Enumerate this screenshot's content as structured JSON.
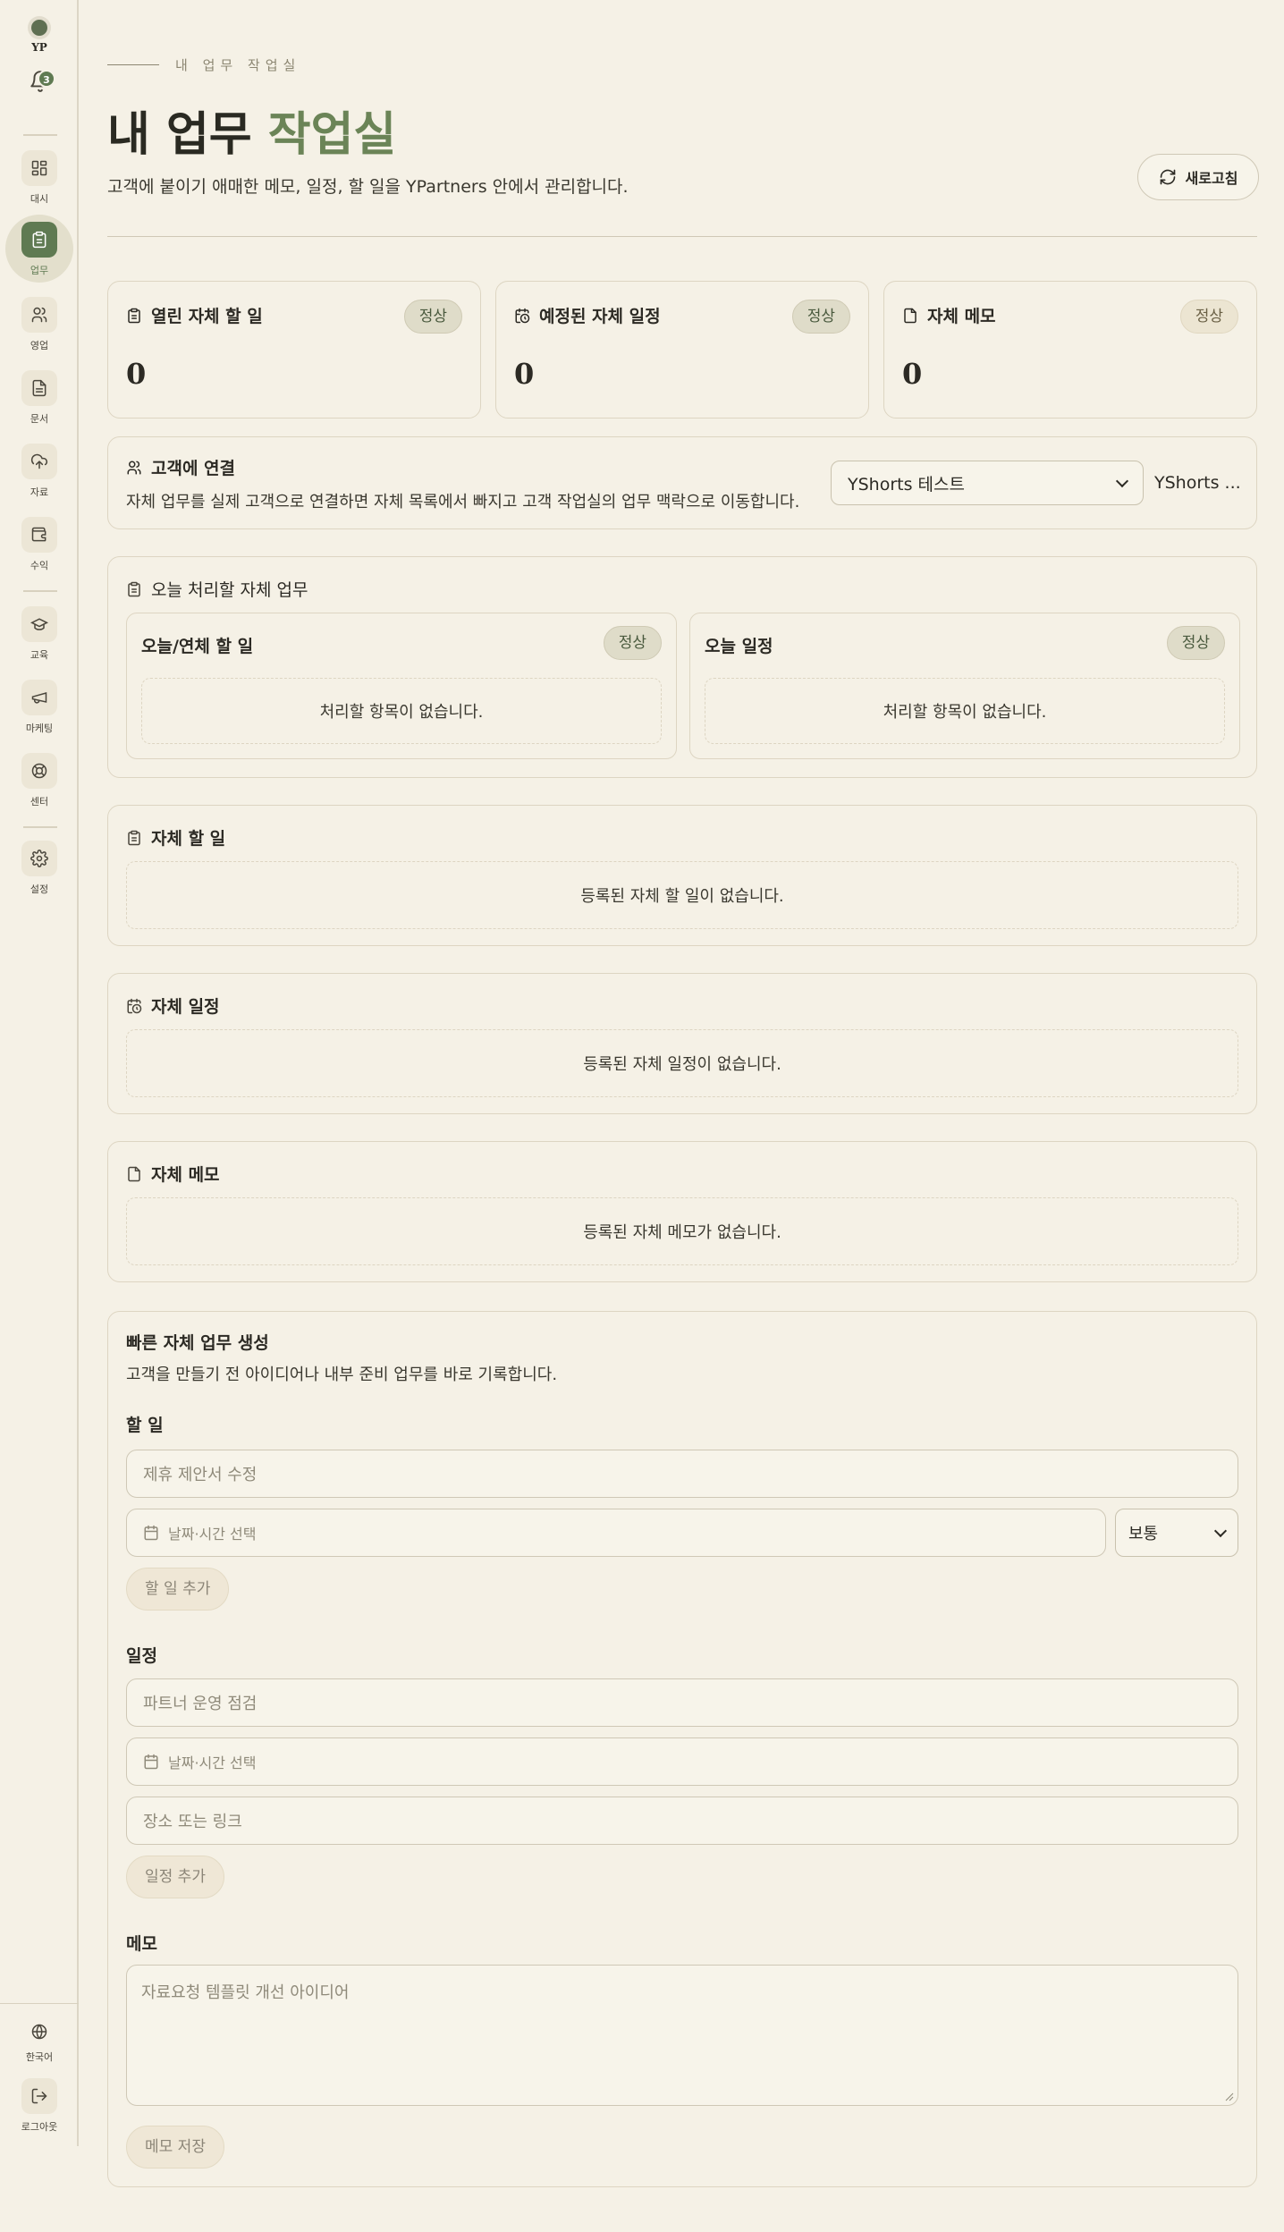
{
  "brand": {
    "text": "YP"
  },
  "notifications": {
    "count": "3"
  },
  "nav": [
    {
      "label": "대시"
    },
    {
      "label": "업무"
    },
    {
      "label": "영업"
    },
    {
      "label": "문서"
    },
    {
      "label": "자료"
    },
    {
      "label": "수익"
    },
    {
      "label": "교육"
    },
    {
      "label": "마케팅"
    },
    {
      "label": "센터"
    },
    {
      "label": "설정"
    }
  ],
  "footer_nav": [
    {
      "label": "한국어"
    },
    {
      "label": "로그아웃"
    }
  ],
  "header": {
    "eyebrow": "내 업무 작업실",
    "title_main": "내 업무 ",
    "title_accent": "작업실",
    "subtitle": "고객에 붙이기 애매한 메모, 일정, 할 일을 YPartners 안에서 관리합니다.",
    "refresh_label": "새로고침"
  },
  "stats": [
    {
      "label": "열린 자체 할 일",
      "status": "정상",
      "value": "0"
    },
    {
      "label": "예정된 자체 일정",
      "status": "정상",
      "value": "0"
    },
    {
      "label": "자체 메모",
      "status": "정상",
      "value": "0"
    }
  ],
  "link_customer": {
    "title": "고객에 연결",
    "description": "자체 업무를 실제 고객으로 연결하면 자체 목록에서 빠지고 고객 작업실의 업무 맥락으로 이동합니다.",
    "selected": "YShorts 테스트",
    "trailing": "YShorts ..."
  },
  "today": {
    "title": "오늘 처리할 자체 업무",
    "columns": [
      {
        "title": "오늘/연체 할 일",
        "status": "정상",
        "empty": "처리할 항목이 없습니다."
      },
      {
        "title": "오늘 일정",
        "status": "정상",
        "empty": "처리할 항목이 없습니다."
      }
    ]
  },
  "todos": {
    "title": "자체 할 일",
    "empty": "등록된 자체 할 일이 없습니다."
  },
  "events": {
    "title": "자체 일정",
    "empty": "등록된 자체 일정이 없습니다."
  },
  "memos": {
    "title": "자체 메모",
    "empty": "등록된 자체 메모가 없습니다."
  },
  "quick": {
    "title": "빠른 자체 업무 생성",
    "description": "고객을 만들기 전 아이디어나 내부 준비 업무를 바로 기록합니다.",
    "todo": {
      "label": "할 일",
      "title_placeholder": "제휴 제안서 수정",
      "date_placeholder": "날짜·시간 선택",
      "priority": "보통",
      "button": "할 일 추가"
    },
    "event": {
      "label": "일정",
      "title_placeholder": "파트너 운영 점검",
      "date_placeholder": "날짜·시간 선택",
      "location_placeholder": "장소 또는 링크",
      "button": "일정 추가"
    },
    "memo": {
      "label": "메모",
      "placeholder": "자료요청 템플릿 개선 아이디어",
      "button": "메모 저장"
    }
  },
  "colors": {
    "accent": "#6b8457",
    "active_nav": "#5f7a52",
    "background": "#f5f1e6"
  }
}
